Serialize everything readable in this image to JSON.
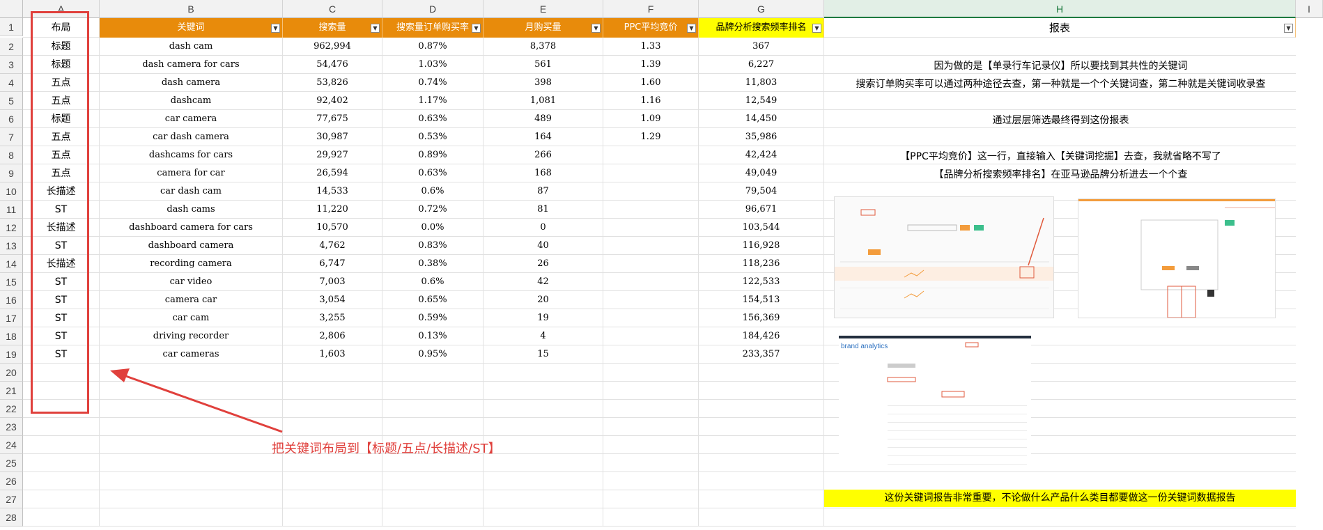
{
  "columns": [
    "A",
    "B",
    "C",
    "D",
    "E",
    "F",
    "G",
    "H",
    "I"
  ],
  "header_row": {
    "a": "布局",
    "b": "关键词",
    "c": "搜索量",
    "d": "搜索量订单购买率",
    "e": "月购买量",
    "f": "PPC平均竞价",
    "g": "品牌分析搜索频率排名",
    "h": "报表"
  },
  "rows": [
    {
      "n": "2",
      "a": "标题",
      "b": "dash cam",
      "c": "962,994",
      "d": "0.87%",
      "e": "8,378",
      "f": "1.33",
      "g": "367"
    },
    {
      "n": "3",
      "a": "标题",
      "b": "dash camera for cars",
      "c": "54,476",
      "d": "1.03%",
      "e": "561",
      "f": "1.39",
      "g": "6,227"
    },
    {
      "n": "4",
      "a": "五点",
      "b": "dash camera",
      "c": "53,826",
      "d": "0.74%",
      "e": "398",
      "f": "1.60",
      "g": "11,803"
    },
    {
      "n": "5",
      "a": "五点",
      "b": "dashcam",
      "c": "92,402",
      "d": "1.17%",
      "e": "1,081",
      "f": "1.16",
      "g": "12,549"
    },
    {
      "n": "6",
      "a": "标题",
      "b": "car camera",
      "c": "77,675",
      "d": "0.63%",
      "e": "489",
      "f": "1.09",
      "g": "14,450"
    },
    {
      "n": "7",
      "a": "五点",
      "b": "car dash camera",
      "c": "30,987",
      "d": "0.53%",
      "e": "164",
      "f": "1.29",
      "g": "35,986"
    },
    {
      "n": "8",
      "a": "五点",
      "b": "dashcams for cars",
      "c": "29,927",
      "d": "0.89%",
      "e": "266",
      "f": "",
      "g": "42,424"
    },
    {
      "n": "9",
      "a": "五点",
      "b": "camera for car",
      "c": "26,594",
      "d": "0.63%",
      "e": "168",
      "f": "",
      "g": "49,049"
    },
    {
      "n": "10",
      "a": "长描述",
      "b": "car dash cam",
      "c": "14,533",
      "d": "0.6%",
      "e": "87",
      "f": "",
      "g": "79,504"
    },
    {
      "n": "11",
      "a": "ST",
      "b": "dash cams",
      "c": "11,220",
      "d": "0.72%",
      "e": "81",
      "f": "",
      "g": "96,671"
    },
    {
      "n": "12",
      "a": "长描述",
      "b": "dashboard camera for cars",
      "c": "10,570",
      "d": "0.0%",
      "e": "0",
      "f": "",
      "g": "103,544"
    },
    {
      "n": "13",
      "a": "ST",
      "b": "dashboard camera",
      "c": "4,762",
      "d": "0.83%",
      "e": "40",
      "f": "",
      "g": "116,928"
    },
    {
      "n": "14",
      "a": "长描述",
      "b": "recording camera",
      "c": "6,747",
      "d": "0.38%",
      "e": "26",
      "f": "",
      "g": "118,236"
    },
    {
      "n": "15",
      "a": "ST",
      "b": "car video",
      "c": "7,003",
      "d": "0.6%",
      "e": "42",
      "f": "",
      "g": "122,533"
    },
    {
      "n": "16",
      "a": "ST",
      "b": "camera car",
      "c": "3,054",
      "d": "0.65%",
      "e": "20",
      "f": "",
      "g": "154,513"
    },
    {
      "n": "17",
      "a": "ST",
      "b": "car cam",
      "c": "3,255",
      "d": "0.59%",
      "e": "19",
      "f": "",
      "g": "156,369"
    },
    {
      "n": "18",
      "a": "ST",
      "b": "driving recorder",
      "c": "2,806",
      "d": "0.13%",
      "e": "4",
      "f": "",
      "g": "184,426"
    },
    {
      "n": "19",
      "a": "ST",
      "b": "car cameras",
      "c": "1,603",
      "d": "0.95%",
      "e": "15",
      "f": "",
      "g": "233,357"
    }
  ],
  "empty_rows": [
    "20",
    "21",
    "22",
    "23",
    "24",
    "25",
    "26",
    "27",
    "28"
  ],
  "report": {
    "line1": "因为做的是【单录行车记录仪】所以要找到其共性的关键词",
    "line2": "搜索订单购买率可以通过两种途径去查，第一种就是一个个关键词查，第二种就是关键词收录查",
    "line3": "通过层层筛选最终得到这份报表",
    "line4": "【PPC平均竞价】这一行，直接输入【关键词挖掘】去查，我就省略不写了",
    "line5": "【品牌分析搜索频率排名】在亚马逊品牌分析进去一个个查",
    "footer": "这份关键词报告非常重要，不论做什么产品什么类目都要做这一份关键词数据报告",
    "thumb3_brand": "brand analytics"
  },
  "annotation": "把关键词布局到【标题/五点/长描述/ST】",
  "colors": {
    "header_orange": "#e88b0b",
    "header_yellow": "#ffff00",
    "annotation_red": "#e0403c",
    "grid": "#e1e1e1"
  }
}
